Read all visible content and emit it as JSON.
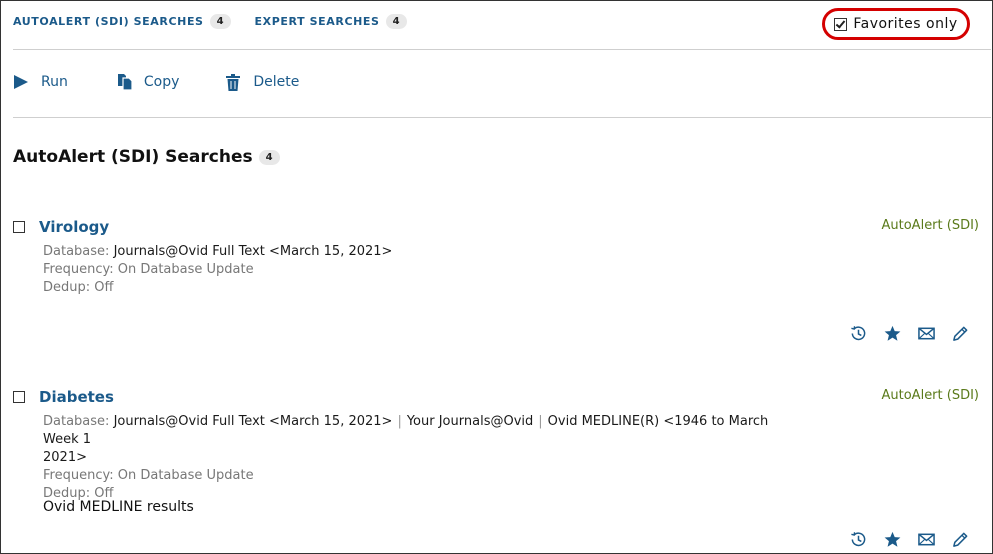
{
  "tabs": [
    {
      "label": "AUTOALERT (SDI) SEARCHES",
      "count": "4"
    },
    {
      "label": "EXPERT SEARCHES",
      "count": "4"
    }
  ],
  "favorites": {
    "label": "Favorites only",
    "checked": true
  },
  "toolbar": {
    "run_label": "Run",
    "copy_label": "Copy",
    "delete_label": "Delete"
  },
  "section": {
    "title": "AutoAlert (SDI) Searches",
    "count": "4"
  },
  "labels": {
    "database": "Database:",
    "frequency": "Frequency:",
    "dedup": "Dedup:"
  },
  "items": [
    {
      "title": "Virology",
      "type": "AutoAlert (SDI)",
      "databases": [
        "Journals@Ovid Full Text <March 15, 2021>"
      ],
      "frequency": "On Database Update",
      "dedup": "Off"
    },
    {
      "title": "Diabetes",
      "type": "AutoAlert (SDI)",
      "databases": [
        "Journals@Ovid Full Text <March 15, 2021>",
        "Your Journals@Ovid",
        "Ovid MEDLINE(R) <1946 to March Week 1",
        "2021>"
      ],
      "frequency": "On Database Update",
      "dedup": "Off",
      "note": "Ovid MEDLINE results"
    }
  ],
  "icons": {
    "run": "play-icon",
    "copy": "copy-icon",
    "delete": "trash-icon",
    "history": "history-icon",
    "favorite": "star-icon",
    "email": "email-icon",
    "edit": "pencil-icon"
  },
  "colors": {
    "link": "#1b5a8a",
    "type_label": "#5a7a1a",
    "highlight_ring": "#d40000"
  }
}
